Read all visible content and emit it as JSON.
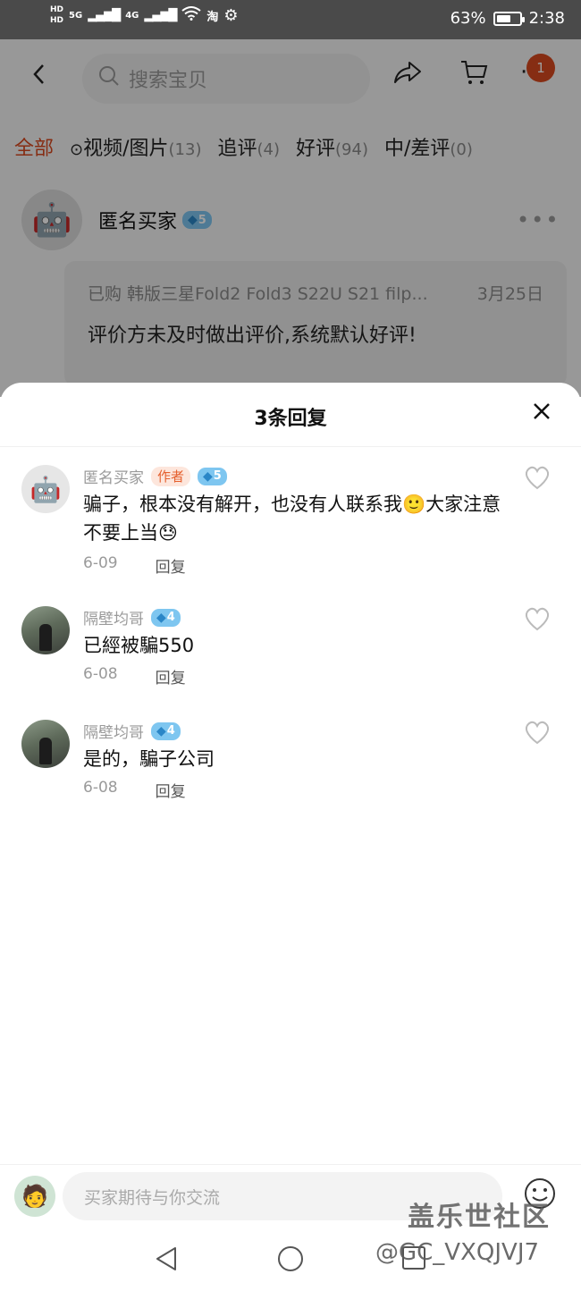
{
  "status_bar": {
    "hd_top": "HD",
    "hd_bottom": "HD",
    "signal_5g": "5G",
    "signal_4g": "4G",
    "taobao_glyph": "淘",
    "battery": "63%",
    "battery_level": 0.63,
    "time": "2:38"
  },
  "topnav": {
    "search_placeholder": "搜索宝贝",
    "cart_badge": "1"
  },
  "filters": [
    {
      "label": "全部",
      "count": ""
    },
    {
      "label": "视频/图片",
      "count": "(13)"
    },
    {
      "label": "追评",
      "count": "(4)"
    },
    {
      "label": "好评",
      "count": "(94)"
    },
    {
      "label": "中/差评",
      "count": "(0)"
    }
  ],
  "review": {
    "name": "匿名买家",
    "level": "5",
    "purchased": "已购 韩版三星Fold2 Fold3 S22U S21 filp...",
    "date": "3月25日",
    "text": "评价方未及时做出评价,系统默认好评!"
  },
  "sheet": {
    "title": "3条回复",
    "replies": [
      {
        "name": "匿名买家",
        "tag": "作者",
        "level": "5",
        "text": "骗子，根本没有解开，也没有人联系我🙂大家注意不要上当😓",
        "date": "6-09",
        "reply_label": "回复"
      },
      {
        "name": "隔壁均哥",
        "tag": "",
        "level": "4",
        "text": "已經被騙550",
        "date": "6-08",
        "reply_label": "回复"
      },
      {
        "name": "隔壁均哥",
        "tag": "",
        "level": "4",
        "text": "是的，騙子公司",
        "date": "6-08",
        "reply_label": "回复"
      }
    ]
  },
  "input": {
    "placeholder": "买家期待与你交流"
  },
  "watermark": {
    "line1": "盖乐世社区",
    "line2": "@GC_VXQJVJ7"
  }
}
